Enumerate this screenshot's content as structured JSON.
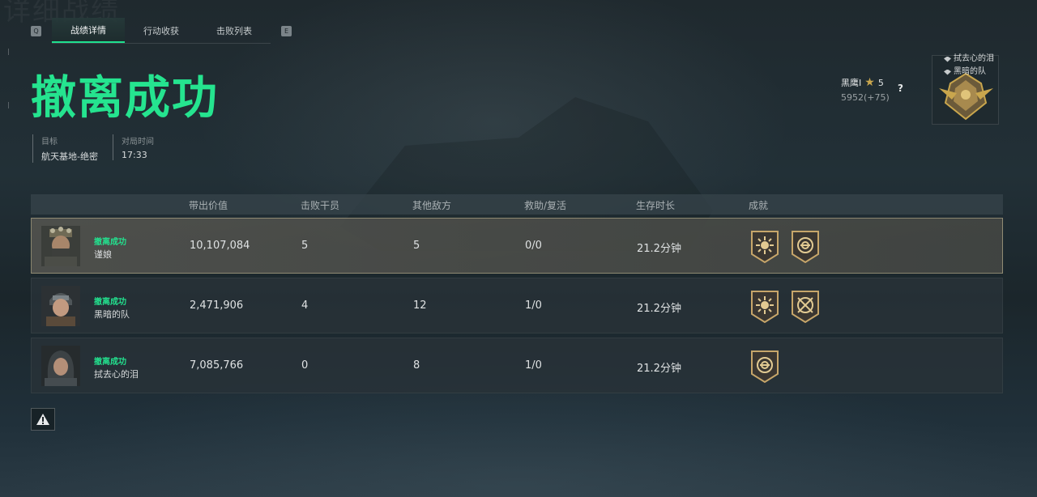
{
  "tabs": [
    {
      "label": "战绩详情",
      "active": true
    },
    {
      "label": "行动收获",
      "active": false
    },
    {
      "label": "击败列表",
      "active": false
    }
  ],
  "key_hints": {
    "left": "Q",
    "right": "E"
  },
  "title": "撤离成功",
  "info": {
    "target_label": "目标",
    "target_value": "航天基地-绝密",
    "time_label": "对局时间",
    "time_value": "17:33"
  },
  "player": {
    "name": "黑鹰I",
    "stars": "5",
    "score": "5952(+75)",
    "help": "?"
  },
  "team": [
    "拭去心的泪",
    "黑暗的队"
  ],
  "table": {
    "headers": [
      "带出价值",
      "击败干员",
      "其他敌方",
      "救助/复活",
      "生存时长",
      "成就"
    ],
    "rows": [
      {
        "status": "撤离成功",
        "name": "谨娘",
        "value": "10,107,084",
        "kills": "5",
        "others": "5",
        "assist": "0/0",
        "survival": "21.2分钟",
        "achievements": [
          "sun-badge",
          "shield-badge"
        ],
        "highlight": true
      },
      {
        "status": "撤离成功",
        "name": "黑暗的队",
        "value": "2,471,906",
        "kills": "4",
        "others": "12",
        "assist": "1/0",
        "survival": "21.2分钟",
        "achievements": [
          "sun-badge",
          "crossed-badge"
        ],
        "highlight": false
      },
      {
        "status": "撤离成功",
        "name": "拭去心的泪",
        "value": "7,085,766",
        "kills": "0",
        "others": "8",
        "assist": "1/0",
        "survival": "21.2分钟",
        "achievements": [
          "shield-badge"
        ],
        "highlight": false
      }
    ]
  },
  "colors": {
    "accent": "#25e48f",
    "gold": "#c9a64d"
  }
}
